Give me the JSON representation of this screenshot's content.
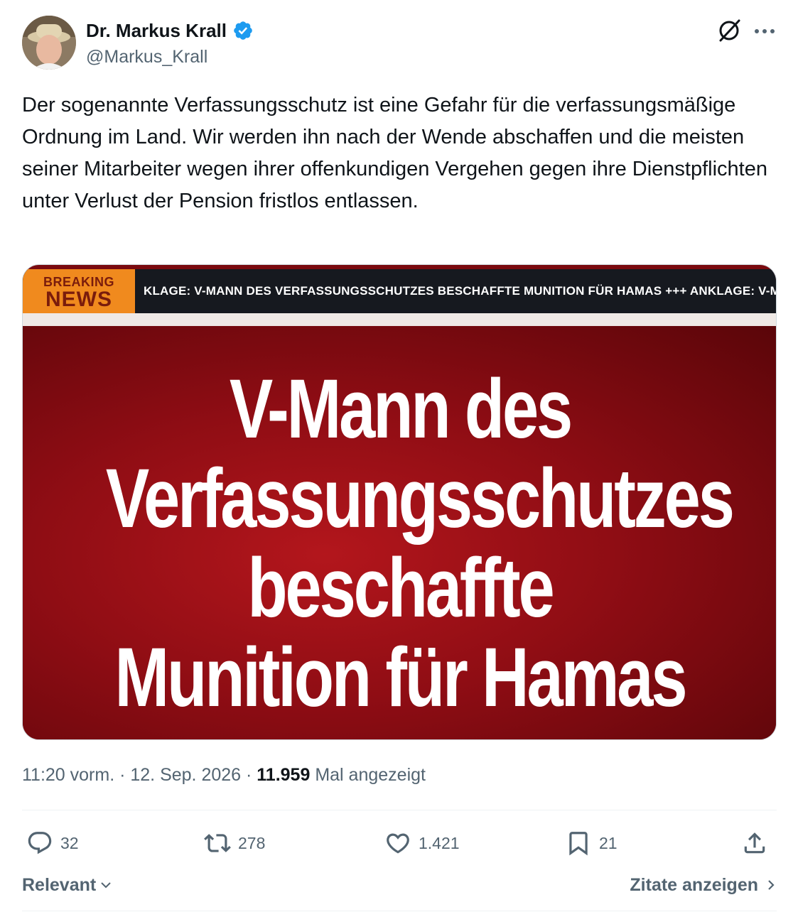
{
  "author": {
    "display_name": "Dr. Markus Krall",
    "handle": "@Markus_Krall"
  },
  "tweet": {
    "text": "Der sogenannte Verfassungsschutz ist eine Gefahr für die verfassungsmäßige Ordnung im Land. Wir werden ihn nach der Wende abschaffen und die meisten seiner Mitarbeiter wegen ihrer offenkundigen Vergehen gegen ihre Dienstpflichten unter Verlust der Pension fristlos entlassen."
  },
  "media": {
    "breaking_line1": "BREAKING",
    "breaking_line2": "NEWS",
    "ticker": "KLAGE: V-MANN DES VERFASSUNGSSCHUTZES BESCHAFFTE MUNITION FÜR HAMAS  +++  ANKLAGE: V-MANN",
    "headline": [
      "V-Mann des",
      "Verfassungsschutzes",
      "beschaffte",
      "Munition für Hamas"
    ]
  },
  "meta": {
    "time_date": "11:20 vorm. · 12. Sep. 2026 · ",
    "views": "11.959",
    "views_label": " Mal angezeigt"
  },
  "actions": {
    "replies": "32",
    "reposts": "278",
    "likes": "1.421",
    "bookmarks": "21"
  },
  "footer": {
    "sort_label": "Relevant",
    "quotes_label": "Zitate anzeigen"
  },
  "colors": {
    "verified": "#1d9bf0",
    "secondary_text": "#536471",
    "breaking_orange": "#f08a1e",
    "headline_red": "#a3121a"
  },
  "icons": [
    "verified-badge-icon",
    "grok-icon",
    "more-icon",
    "reply-icon",
    "repost-icon",
    "like-icon",
    "bookmark-icon",
    "share-icon",
    "chevron-down-icon",
    "chevron-right-icon"
  ]
}
